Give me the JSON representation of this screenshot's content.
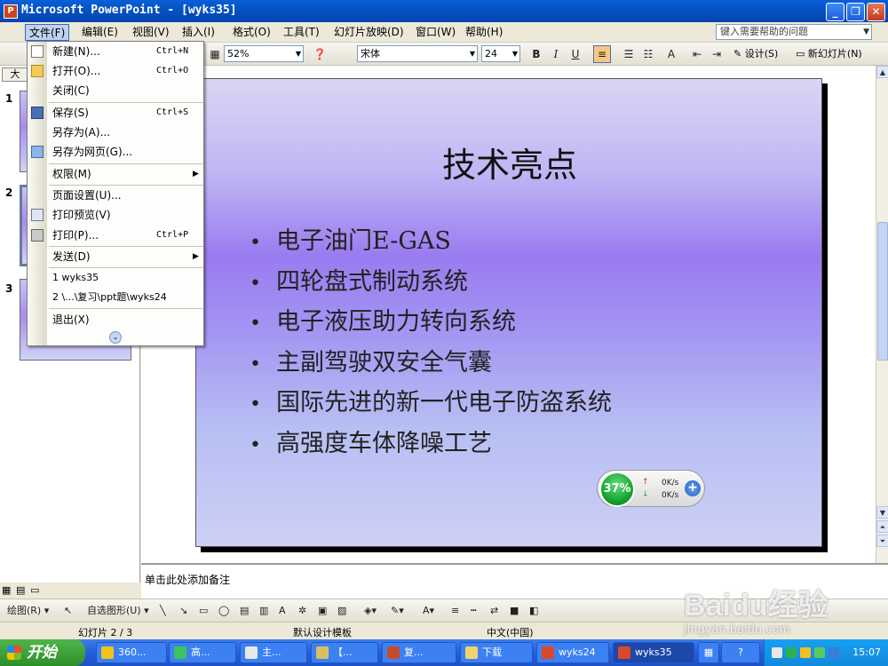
{
  "window": {
    "title": "Microsoft PowerPoint - [wyks35]",
    "app_icon": "powerpoint-icon",
    "buttons": [
      "_",
      "❐",
      "✕"
    ]
  },
  "menubar": {
    "items": [
      "文件(F)",
      "编辑(E)",
      "视图(V)",
      "插入(I)",
      "格式(O)",
      "工具(T)",
      "幻灯片放映(D)",
      "窗口(W)",
      "帮助(H)"
    ],
    "help_placeholder": "键入需要帮助的问题"
  },
  "toolbar": {
    "zoom": "52%",
    "font_name": "宋体",
    "font_size": "24",
    "bold": "B",
    "italic": "I",
    "underline": "U",
    "design_label": "设计(S)",
    "new_slide_label": "新幻灯片(N)"
  },
  "left_pane": {
    "tab_label": "大",
    "slide_numbers": [
      "1",
      "2",
      "3"
    ],
    "selected_slide": 2
  },
  "file_menu": {
    "items": [
      {
        "label": "新建(N)...",
        "shortcut": "Ctrl+N",
        "icon": "new-document-icon"
      },
      {
        "label": "打开(O)...",
        "shortcut": "Ctrl+O",
        "icon": "open-folder-icon"
      },
      {
        "label": "关闭(C)",
        "shortcut": "",
        "icon": ""
      },
      {
        "label": "保存(S)",
        "shortcut": "Ctrl+S",
        "icon": "save-disk-icon"
      },
      {
        "label": "另存为(A)...",
        "shortcut": "",
        "icon": ""
      },
      {
        "label": "另存为网页(G)...",
        "shortcut": "",
        "icon": "web-page-icon"
      },
      {
        "label": "权限(M)",
        "shortcut": "",
        "icon": "",
        "submenu": true
      },
      {
        "label": "页面设置(U)...",
        "shortcut": "",
        "icon": ""
      },
      {
        "label": "打印预览(V)",
        "shortcut": "",
        "icon": "print-preview-icon"
      },
      {
        "label": "打印(P)...",
        "shortcut": "Ctrl+P",
        "icon": "printer-icon"
      },
      {
        "label": "发送(D)",
        "shortcut": "",
        "icon": "",
        "submenu": true
      },
      {
        "label": "1 wyks35",
        "shortcut": "",
        "icon": ""
      },
      {
        "label": "2 \\...\\复习\\ppt题\\wyks24",
        "shortcut": "",
        "icon": ""
      },
      {
        "label": "退出(X)",
        "shortcut": "",
        "icon": ""
      }
    ]
  },
  "slide": {
    "title": "技术亮点",
    "bullets": [
      "电子油门E-GAS",
      "四轮盘式制动系统",
      "电子液压助力转向系统",
      "主副驾驶双安全气囊",
      "国际先进的新一代电子防盗系统",
      "高强度车体降噪工艺"
    ]
  },
  "net_widget": {
    "percent": "37%",
    "up_rate": "0K/s",
    "down_rate": "0K/s"
  },
  "notes_placeholder": "单击此处添加备注",
  "drawing_toolbar": {
    "draw_label": "绘图(R)",
    "autoshapes_label": "自选图形(U)"
  },
  "status_bar": {
    "slide_info": "幻灯片 2 / 3",
    "template": "默认设计模板",
    "language": "中文(中国)"
  },
  "taskbar": {
    "start_label": "开始",
    "tasks": [
      "360...",
      "高...",
      "主...",
      "【...",
      "复...",
      "下载",
      "wyks24",
      "wyks35"
    ],
    "clock": "15:07"
  },
  "watermark": {
    "brand": "Baidu经验",
    "url": "jingyan.baidu.com"
  },
  "colors": {
    "titlebar": "#0453c4",
    "menu_highlight": "#c1d2ee",
    "slide_gradient_mid": "#9a7bf0",
    "taskbar": "#245edb",
    "start_button": "#2e8f2a"
  }
}
